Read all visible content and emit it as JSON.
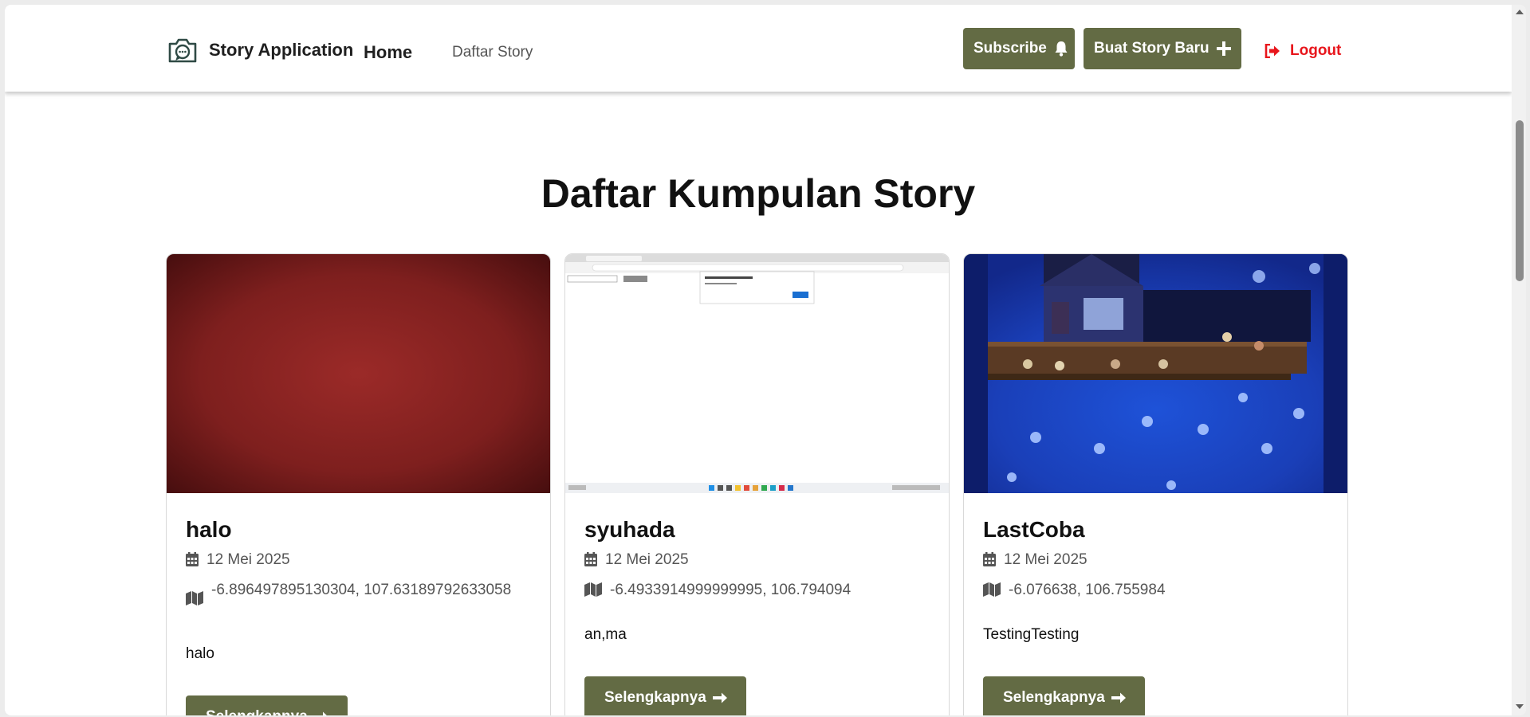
{
  "nav": {
    "brand": "Story Application",
    "home": "Home",
    "daftar": "Daftar Story",
    "subscribe": "Subscribe",
    "buat": "Buat Story Baru",
    "logout": "Logout"
  },
  "page": {
    "heading": "Daftar Kumpulan Story"
  },
  "stories": [
    {
      "name": "halo",
      "date": "12 Mei 2025",
      "location": "-6.896497895130304, 107.63189792633058",
      "description": "halo",
      "button": "Selengkapnya"
    },
    {
      "name": "syuhada",
      "date": "12 Mei 2025",
      "location": "-6.4933914999999995, 106.794094",
      "description": "an,ma",
      "button": "Selengkapnya"
    },
    {
      "name": "LastCoba",
      "date": "12 Mei 2025",
      "location": "-6.076638, 106.755984",
      "description": "TestingTesting",
      "button": "Selengkapnya"
    }
  ],
  "colors": {
    "accent": "#636b44",
    "logout": "#e8161c",
    "brand_icon": "#2f4a45"
  },
  "icons": {
    "brand": "camera-chat-icon",
    "subscribe": "bell-icon",
    "buat": "plus-icon",
    "logout": "sign-out-icon",
    "date": "calendar-icon",
    "location": "map-icon",
    "more": "arrow-right-icon"
  }
}
